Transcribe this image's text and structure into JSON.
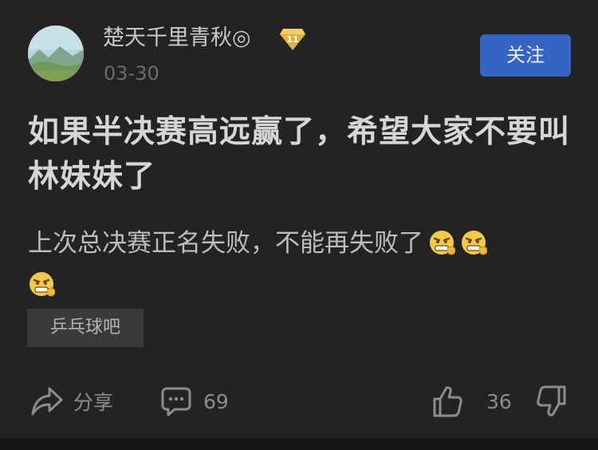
{
  "author": {
    "name": "楚天千里青秋◎",
    "level_badge": "11",
    "date": "03-30",
    "follow_label": "关注"
  },
  "post": {
    "title": "如果半决赛高远赢了，希望大家不要叫林妹妹了",
    "body_text": "上次总决赛正名失败，不能再失败了",
    "emoji_icon": "grimacing-fist-emoji",
    "emoji_count": 3
  },
  "tag": {
    "label": "乒乓球吧"
  },
  "actions": {
    "share_label": "分享",
    "comment_count": "69",
    "like_count": "36"
  },
  "colors": {
    "background": "#232324",
    "accent": "#3563c6",
    "badge": "#e0b23a"
  }
}
